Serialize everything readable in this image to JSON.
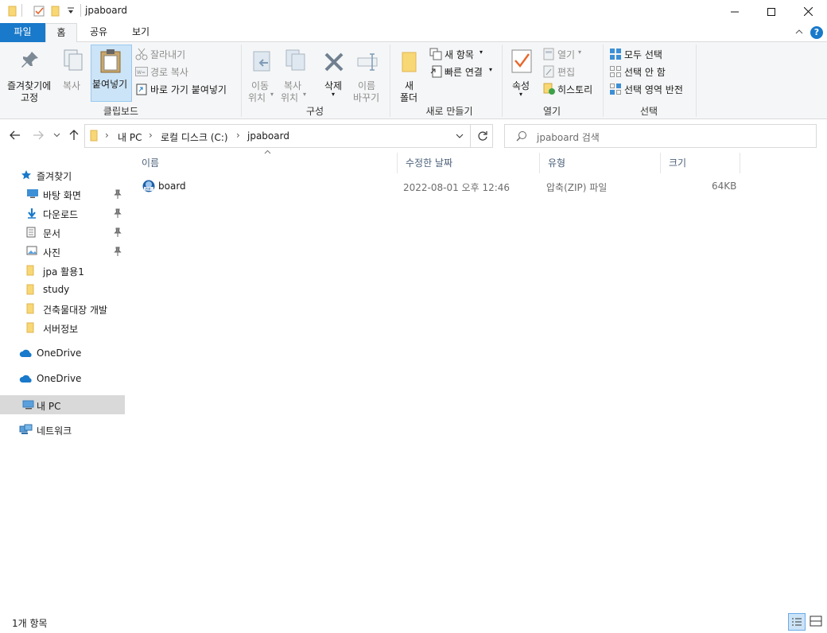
{
  "window": {
    "title": "jpaboard"
  },
  "tabs": {
    "file": "파일",
    "home": "홈",
    "share": "공유",
    "view": "보기"
  },
  "ribbon": {
    "pin_quick": [
      "즐겨찾기에",
      "고정"
    ],
    "copy": "복사",
    "paste": "붙여넣기",
    "cut": "잘라내기",
    "copy_path": "경로 복사",
    "paste_shortcut": "바로 가기 붙여넣기",
    "group_clipboard": "클립보드",
    "move_to": [
      "이동",
      "위치"
    ],
    "copy_to": [
      "복사",
      "위치"
    ],
    "delete": "삭제",
    "rename": [
      "이름",
      "바꾸기"
    ],
    "group_organize": "구성",
    "new_folder": [
      "새",
      "폴더"
    ],
    "new_item": "새 항목",
    "easy_access": "빠른 연결",
    "group_new": "새로 만들기",
    "properties": "속성",
    "open": "열기",
    "edit": "편집",
    "history": "히스토리",
    "group_open": "열기",
    "select_all": "모두 선택",
    "select_none": "선택 안 함",
    "invert_selection": "선택 영역 반전",
    "group_select": "선택"
  },
  "address": {
    "crumbs": [
      "내 PC",
      "로컬 디스크 (C:)",
      "jpaboard"
    ],
    "search_placeholder": "jpaboard 검색"
  },
  "nav": {
    "quick_access": "즐겨찾기",
    "items": [
      {
        "label": "바탕 화면",
        "pinned": true,
        "icon": "desktop-icon"
      },
      {
        "label": "다운로드",
        "pinned": true,
        "icon": "download-icon"
      },
      {
        "label": "문서",
        "pinned": true,
        "icon": "document-icon"
      },
      {
        "label": "사진",
        "pinned": true,
        "icon": "picture-icon"
      },
      {
        "label": "jpa 활용1",
        "pinned": false,
        "icon": "folder-icon"
      },
      {
        "label": "study",
        "pinned": false,
        "icon": "folder-icon"
      },
      {
        "label": "건축물대장 개발",
        "pinned": false,
        "icon": "folder-icon"
      },
      {
        "label": "서버정보",
        "pinned": false,
        "icon": "folder-icon"
      }
    ],
    "onedrive1": "OneDrive",
    "onedrive2": "OneDrive",
    "this_pc": "내 PC",
    "network": "네트워크"
  },
  "columns": {
    "name": "이름",
    "date": "수정한 날짜",
    "type": "유형",
    "size": "크기"
  },
  "files": [
    {
      "name": "board",
      "date": "2022-08-01 오후 12:46",
      "type": "압축(ZIP) 파일",
      "size": "64KB"
    }
  ],
  "status": {
    "count": "1개 항목"
  },
  "colors": {
    "accent": "#1979ca",
    "folder": "#f8d775"
  }
}
